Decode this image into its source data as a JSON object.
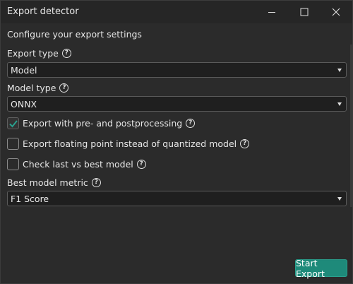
{
  "window": {
    "title": "Export detector"
  },
  "main": {
    "subtitle": "Configure your export settings",
    "export_type": {
      "label": "Export type",
      "value": "Model"
    },
    "model_type": {
      "label": "Model type",
      "value": "ONNX"
    },
    "checkboxes": [
      {
        "label": "Export with pre- and postprocessing",
        "checked": true
      },
      {
        "label": "Export floating point instead of quantized model",
        "checked": false
      },
      {
        "label": "Check last vs best model",
        "checked": false
      }
    ],
    "best_metric": {
      "label": "Best model metric",
      "value": "F1 Score"
    },
    "start_button": "Start Export"
  },
  "colors": {
    "accent": "#1e8a7a",
    "check": "#2aa08e",
    "background": "#2b2b2b"
  },
  "icons": {
    "minimize": "minimize-icon",
    "maximize": "maximize-icon",
    "close": "close-icon",
    "help": "help-icon",
    "check": "checkmark-icon",
    "dropdown": "chevron-down-icon"
  }
}
